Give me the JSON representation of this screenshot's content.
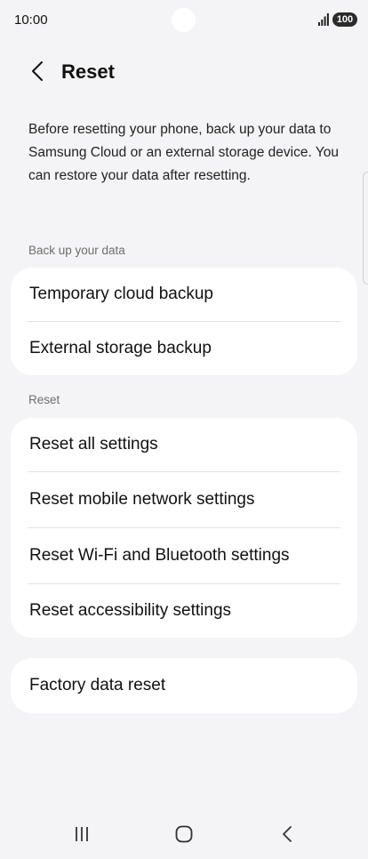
{
  "status_bar": {
    "time": "10:00",
    "battery": "100",
    "icons": [
      "signal-icon",
      "battery-icon"
    ]
  },
  "header": {
    "title": "Reset",
    "back_icon": "chevron-left-icon"
  },
  "description": "Before resetting your phone, back up your data to Samsung Cloud or an external storage device. You can restore your data after resetting.",
  "sections": {
    "backup": {
      "label": "Back up your data",
      "items": [
        "Temporary cloud backup",
        "External storage backup"
      ]
    },
    "reset": {
      "label": "Reset",
      "items": [
        "Reset all settings",
        "Reset mobile network settings",
        "Reset Wi-Fi and Bluetooth settings",
        "Reset accessibility settings"
      ]
    },
    "factory": {
      "items": [
        "Factory data reset"
      ]
    }
  },
  "nav_bar": {
    "icons": [
      "recents-icon",
      "home-icon",
      "back-icon"
    ]
  },
  "colors": {
    "background": "#f4f4f6",
    "card": "#ffffff",
    "section_label": "#6e6e6e",
    "divider": "#e2e2e2"
  }
}
